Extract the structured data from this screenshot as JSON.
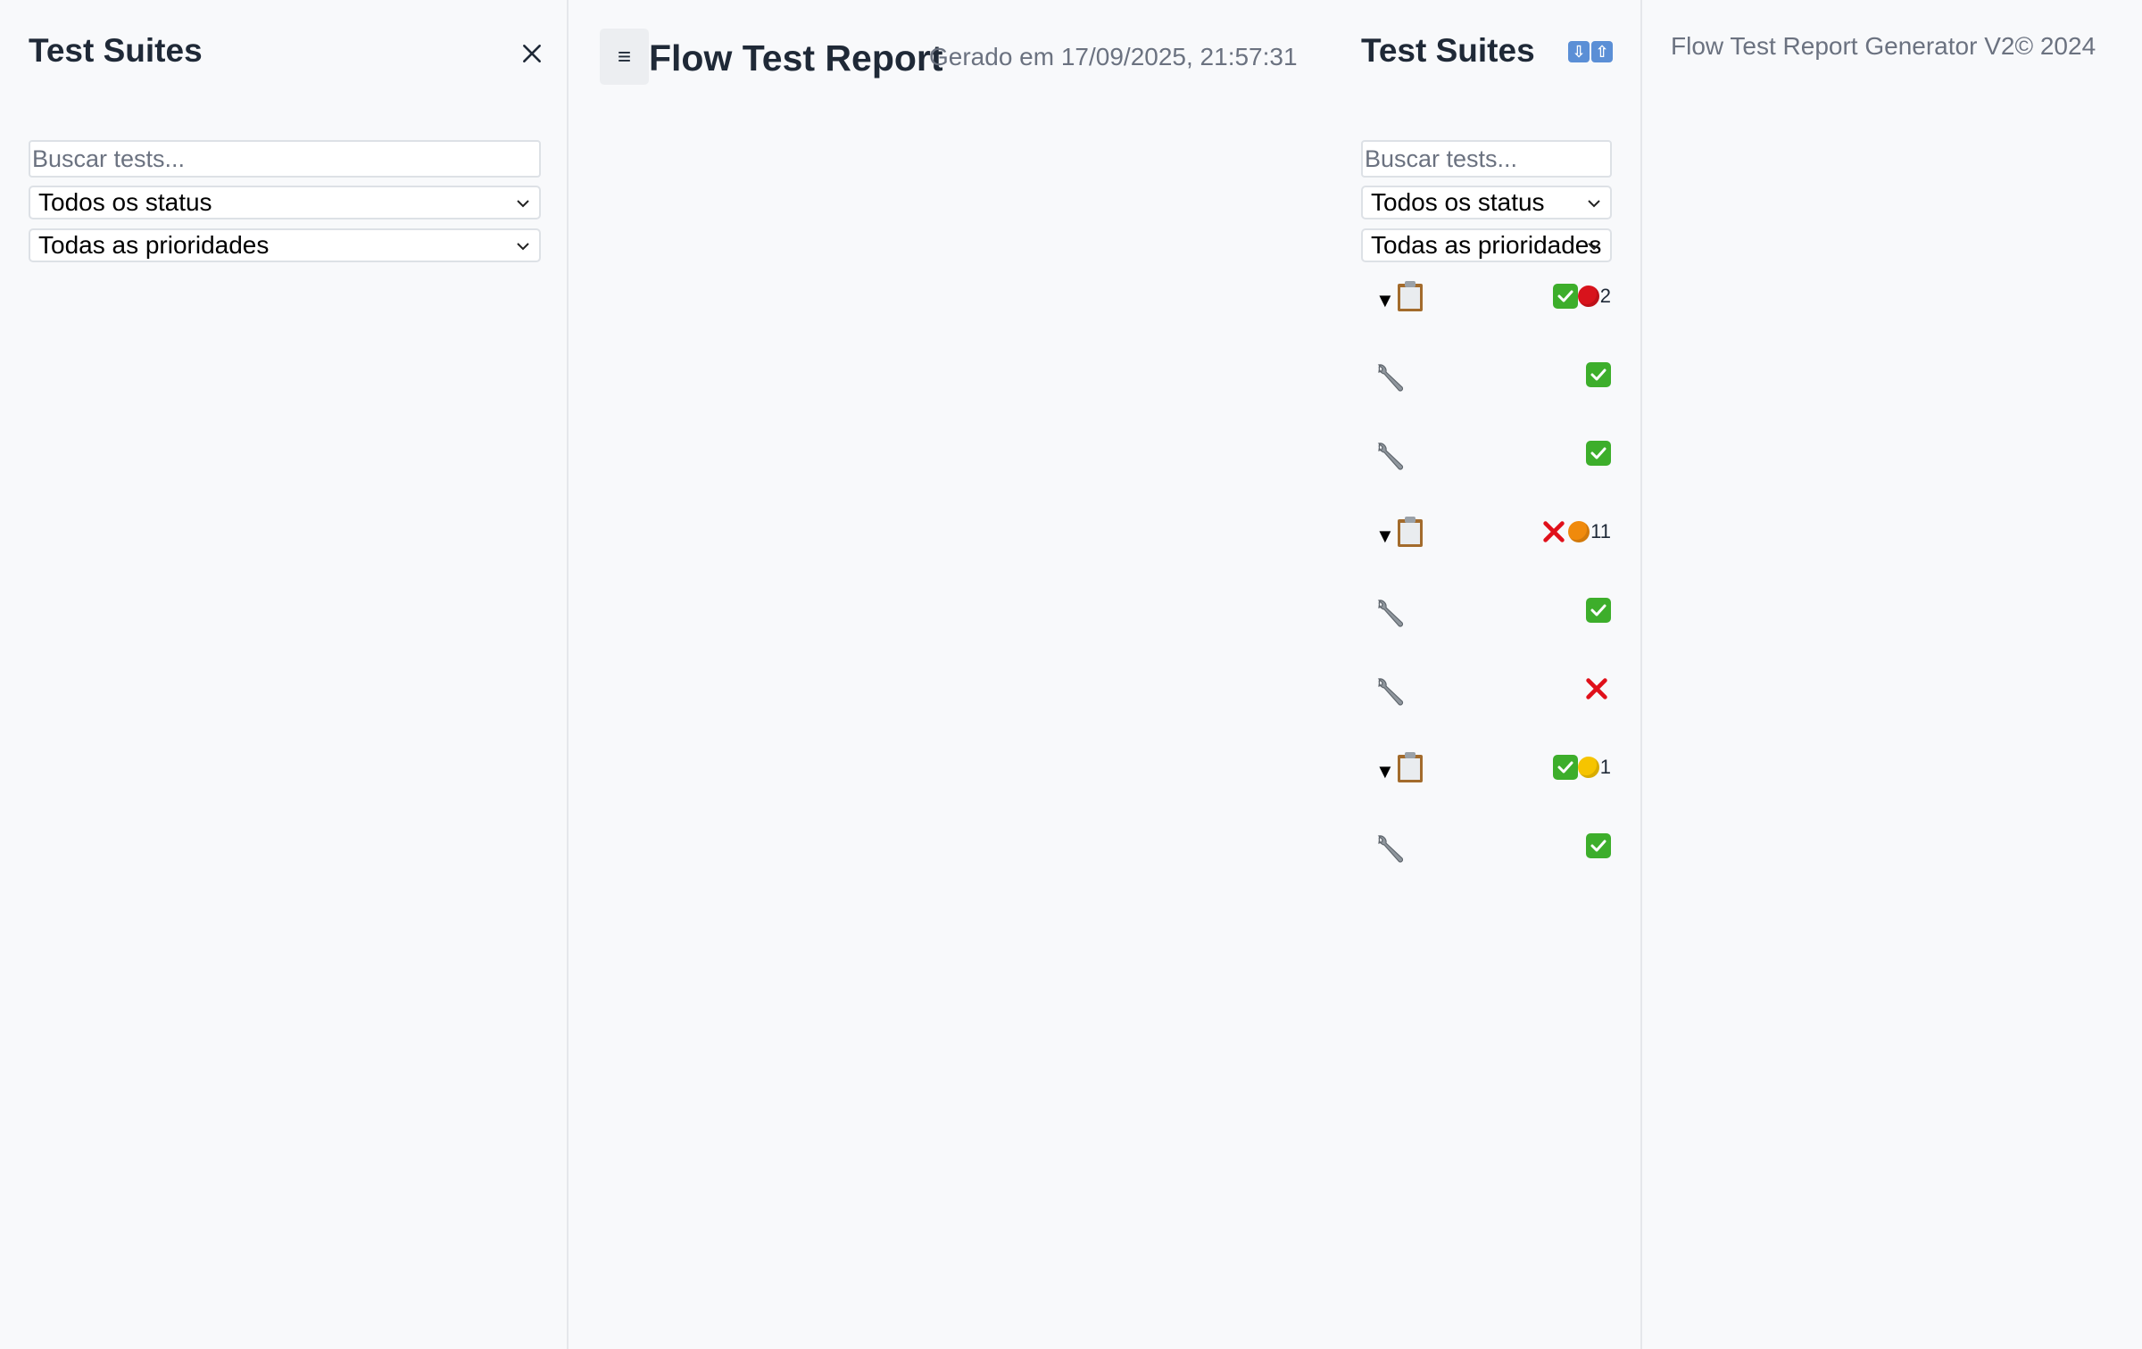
{
  "sidebar": {
    "title": "Test Suites",
    "search_placeholder": "Buscar tests...",
    "status_filter": "Todos os status",
    "priority_filter": "Todas as prioridades"
  },
  "header": {
    "menu_glyph": "≡",
    "title": "Flow Test Report",
    "generated_at": "Gerado em 17/09/2025, 21:57:31"
  },
  "panel": {
    "title": "Test Suites",
    "search_placeholder": "Buscar tests...",
    "status_filter": "Todos os status",
    "priority_filter": "Todas as prioridades",
    "rows": [
      {
        "kind": "suite",
        "icon": "clipboard-icon",
        "statuses": [
          "check",
          "red-dot"
        ],
        "count": "2"
      },
      {
        "kind": "test",
        "icon": "wrench-icon",
        "statuses": [
          "check"
        ]
      },
      {
        "kind": "test",
        "icon": "wrench-icon",
        "statuses": [
          "check"
        ]
      },
      {
        "kind": "suite",
        "icon": "clipboard-icon",
        "statuses": [
          "cross",
          "orange-dot"
        ],
        "count": "11"
      },
      {
        "kind": "test",
        "icon": "wrench-icon",
        "statuses": [
          "check"
        ]
      },
      {
        "kind": "test",
        "icon": "wrench-icon",
        "statuses": [
          "cross"
        ]
      },
      {
        "kind": "suite",
        "icon": "clipboard-icon",
        "statuses": [
          "check",
          "yellow-dot"
        ],
        "count": "1"
      },
      {
        "kind": "test",
        "icon": "wrench-icon",
        "statuses": [
          "check"
        ]
      }
    ]
  },
  "footer": {
    "credit": "Flow Test Report Generator V2© 2024"
  },
  "colors": {
    "check": "#3dae2b",
    "cross": "#e0101a",
    "red-dot": "#d8131c",
    "orange-dot": "#f08a0c",
    "yellow-dot": "#f6c400"
  }
}
